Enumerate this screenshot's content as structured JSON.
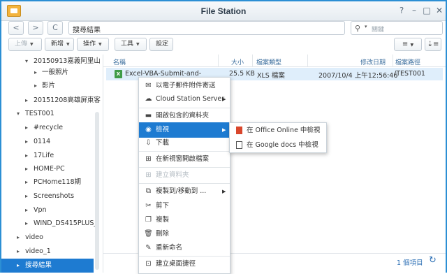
{
  "window": {
    "title": "File Station",
    "controls": [
      "?",
      "–",
      "□",
      "✕"
    ]
  },
  "nav": {
    "back": "<",
    "forward": ">",
    "refresh": "C",
    "path": "搜尋結果",
    "search_placeholder": "關鍵"
  },
  "toolbar": {
    "upload": "上傳",
    "create": "新增",
    "action": "操作",
    "tools": "工具",
    "settings": "設定",
    "list_view_icon": "≡",
    "sort_icon": "⇣≡"
  },
  "sidebar": {
    "items": [
      {
        "label": "20150913嘉義阿里山",
        "toggle": "▾"
      },
      {
        "label": "一般照片",
        "toggle": "▸"
      },
      {
        "label": "影片",
        "toggle": "▸"
      },
      {
        "label": "20151208高雄屏東客",
        "toggle": "▸"
      },
      {
        "label": "TEST001",
        "toggle": "▾"
      },
      {
        "label": "#recycle",
        "toggle": "▸"
      },
      {
        "label": "0114",
        "toggle": "▸"
      },
      {
        "label": "17Life",
        "toggle": "▸"
      },
      {
        "label": "HOME-PC",
        "toggle": "▸"
      },
      {
        "label": "PCHome118期",
        "toggle": "▸"
      },
      {
        "label": "Screenshots",
        "toggle": "▸"
      },
      {
        "label": "Vpn",
        "toggle": "▸"
      },
      {
        "label": "WIND_DS415PLUS_",
        "toggle": "▸"
      },
      {
        "label": "video",
        "toggle": "▸"
      },
      {
        "label": "video_1",
        "toggle": "▸"
      },
      {
        "label": "搜尋結果",
        "toggle": "▸"
      }
    ]
  },
  "table": {
    "columns": [
      "名稱",
      "大小",
      "檔案類型",
      "修改日期",
      "檔案路徑"
    ],
    "rows": [
      {
        "name": "Excel-VBA-Submit-and-",
        "size": "25.5 KB",
        "type": "XLS 檔案",
        "modified": "2007/10/4 上午12:56:46",
        "path": "/TEST001"
      }
    ]
  },
  "status": {
    "count": "1 個項目"
  },
  "context_menu": {
    "items": [
      {
        "label": "以電子郵件附件寄送",
        "icon": "✉"
      },
      {
        "label": "Cloud Station Server",
        "icon": "☁"
      },
      {
        "label": "開啟包含的資料夾",
        "icon": "▬"
      },
      {
        "label": "檢視",
        "icon": "◉"
      },
      {
        "label": "下載",
        "icon": "⇩"
      },
      {
        "label": "在新視窗開啟檔案",
        "icon": "⊞"
      },
      {
        "label": "建立資料夾",
        "icon": "⊞"
      },
      {
        "label": "複製到/移動到 ...",
        "icon": "⧉"
      },
      {
        "label": "剪下",
        "icon": "✂"
      },
      {
        "label": "複製",
        "icon": "❐"
      },
      {
        "label": "刪除",
        "icon": "🗑"
      },
      {
        "label": "重新命名",
        "icon": "✎"
      },
      {
        "label": "建立桌面捷徑",
        "icon": "⊡"
      }
    ]
  },
  "view_submenu": {
    "items": [
      {
        "label": "在 Office Online 中檢視"
      },
      {
        "label": "在 Google docs 中檢視"
      }
    ]
  }
}
